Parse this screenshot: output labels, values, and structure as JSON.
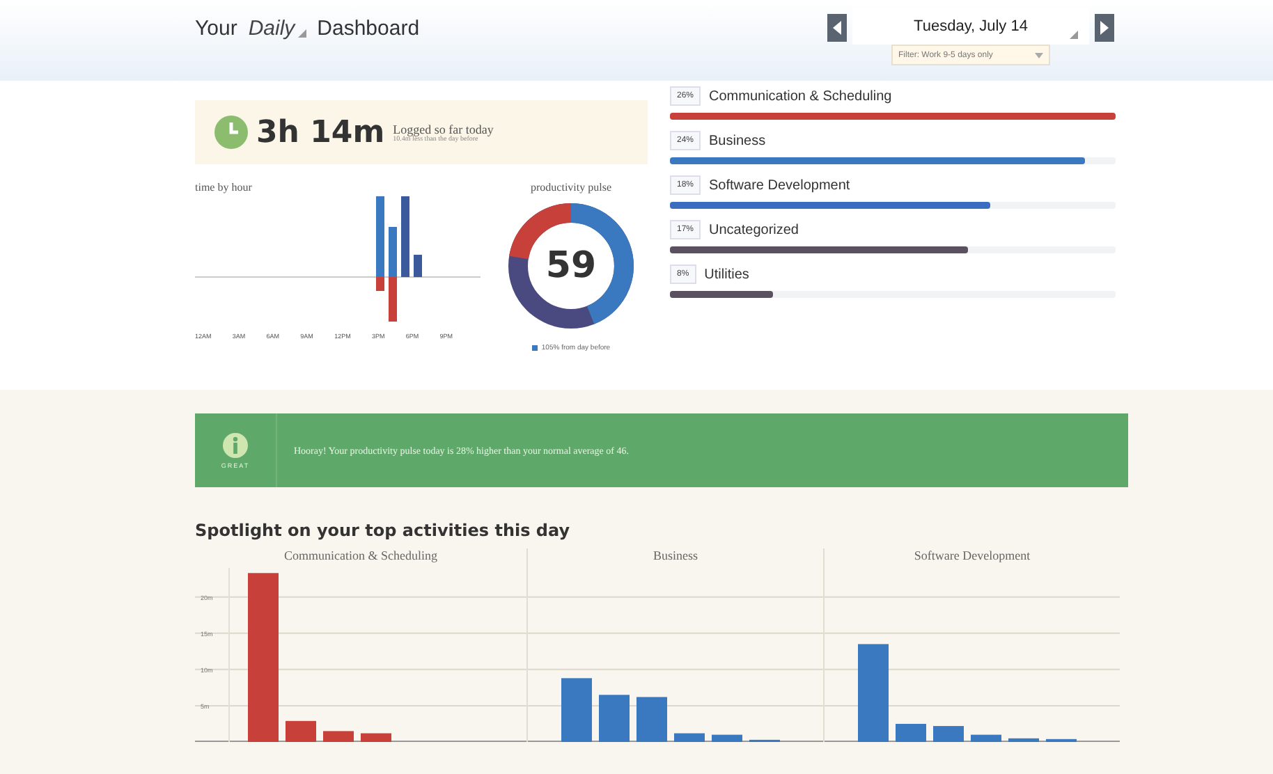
{
  "header": {
    "title_before": "Your",
    "period": "Daily",
    "title_after": "Dashboard",
    "date": "Tuesday, July 14",
    "filter": {
      "value": "Filter: Work 9-5 days only"
    }
  },
  "logged": {
    "time": "3h 14m",
    "label": "Logged so far today",
    "note": "10.4m less than the day before"
  },
  "time_by_hour": {
    "title": "time by hour",
    "hours": [
      "12AM",
      "3AM",
      "6AM",
      "9AM",
      "12PM",
      "3PM",
      "6PM",
      "9PM"
    ]
  },
  "productivity_pulse": {
    "title": "productivity pulse",
    "score": "59",
    "legend": "105% from day before"
  },
  "categories": [
    {
      "percent": "26%",
      "name": "Communication & Scheduling",
      "level": 1.0,
      "color": "#c8403a"
    },
    {
      "percent": "24%",
      "name": "Business",
      "level": 0.93,
      "color": "#3a78c0"
    },
    {
      "percent": "18%",
      "name": "Software Development",
      "level": 0.72,
      "color": "#3a6cc0"
    },
    {
      "percent": "17%",
      "name": "Uncategorized",
      "level": 0.67,
      "color": "#5a5060"
    },
    {
      "percent": "8%",
      "name": "Utilities",
      "level": 0.23,
      "color": "#5a5060"
    }
  ],
  "banner": {
    "badge": "GREAT",
    "message": "Hooray! Your productivity pulse today is 28% higher than your normal average of 46."
  },
  "spotlight": {
    "title": "Spotlight on your top activities this day",
    "panels": [
      {
        "chart_data": {
          "type": "bar",
          "title": "Communication & Scheduling",
          "grid": true,
          "ylim": [
            0,
            24
          ],
          "categories": [
            null,
            null,
            null,
            null
          ],
          "yticks": [
            {
              "value": 5,
              "label": "5m"
            },
            {
              "value": 10,
              "label": "10m"
            },
            {
              "value": 15,
              "label": "15m"
            },
            {
              "value": 20,
              "label": "20m"
            }
          ],
          "series": [
            {
              "color": "#c8403a",
              "values": [
                23.3,
                2.9,
                1.5,
                1.2
              ]
            }
          ]
        }
      },
      {
        "title": "Business",
        "color": "#3a78c0"
      },
      {
        "title": "Software Development",
        "color": "#3a78c0"
      }
    ]
  }
}
